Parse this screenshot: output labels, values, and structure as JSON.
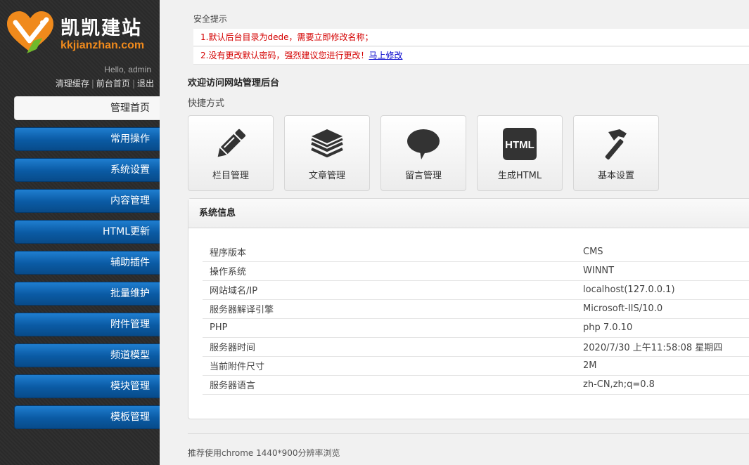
{
  "brand": {
    "name_cn": "凯凯建站",
    "url": "kkjianzhan.com",
    "colors": {
      "orange": "#f08a1c",
      "green": "#6fb92c"
    }
  },
  "header": {
    "greeting": "Hello, admin",
    "links": [
      "清理缓存",
      "前台首页",
      "退出"
    ]
  },
  "sidebar": {
    "items": [
      {
        "label": "管理首页",
        "active": true
      },
      {
        "label": "常用操作"
      },
      {
        "label": "系统设置"
      },
      {
        "label": "内容管理"
      },
      {
        "label": "HTML更新"
      },
      {
        "label": "辅助插件"
      },
      {
        "label": "批量维护"
      },
      {
        "label": "附件管理"
      },
      {
        "label": "频道模型"
      },
      {
        "label": "模块管理"
      },
      {
        "label": "模板管理"
      }
    ],
    "colors": {
      "active_bg": "#f7f7f7",
      "item_bg": "#0a5aa3"
    }
  },
  "security": {
    "title": "安全提示",
    "tip1": "1.默认后台目录为dede，需要立即修改名称；",
    "tip2": "2.没有更改默认密码，强烈建议您进行更改！",
    "tip2_link": "马上修改",
    "color": "#d40000"
  },
  "main": {
    "welcome": "欢迎访问网站管理后台",
    "quick_label": "快捷方式",
    "shortcuts": [
      {
        "label": "栏目管理",
        "icon": "pencil-icon"
      },
      {
        "label": "文章管理",
        "icon": "stack-icon"
      },
      {
        "label": "留言管理",
        "icon": "speech-bubble-icon"
      },
      {
        "label": "生成HTML",
        "icon": "html-icon",
        "icon_text": "HTML"
      },
      {
        "label": "基本设置",
        "icon": "hammer-icon"
      }
    ]
  },
  "sysinfo": {
    "title": "系统信息",
    "rows": [
      {
        "key": "程序版本",
        "value": "CMS"
      },
      {
        "key": "操作系统",
        "value": "WINNT"
      },
      {
        "key": "网站域名/IP",
        "value": "localhost(127.0.0.1)"
      },
      {
        "key": "服务器解译引擎",
        "value": "Microsoft-IIS/10.0"
      },
      {
        "key": "PHP",
        "value": "php 7.0.10"
      },
      {
        "key": "服务器时间",
        "value": "2020/7/30 上午11:58:08 星期四"
      },
      {
        "key": "当前附件尺寸",
        "value": "2M"
      },
      {
        "key": "服务器语言",
        "value": "zh-CN,zh;q=0.8"
      }
    ]
  },
  "footer": {
    "text": "推荐使用chrome 1440*900分辨率浏览"
  }
}
